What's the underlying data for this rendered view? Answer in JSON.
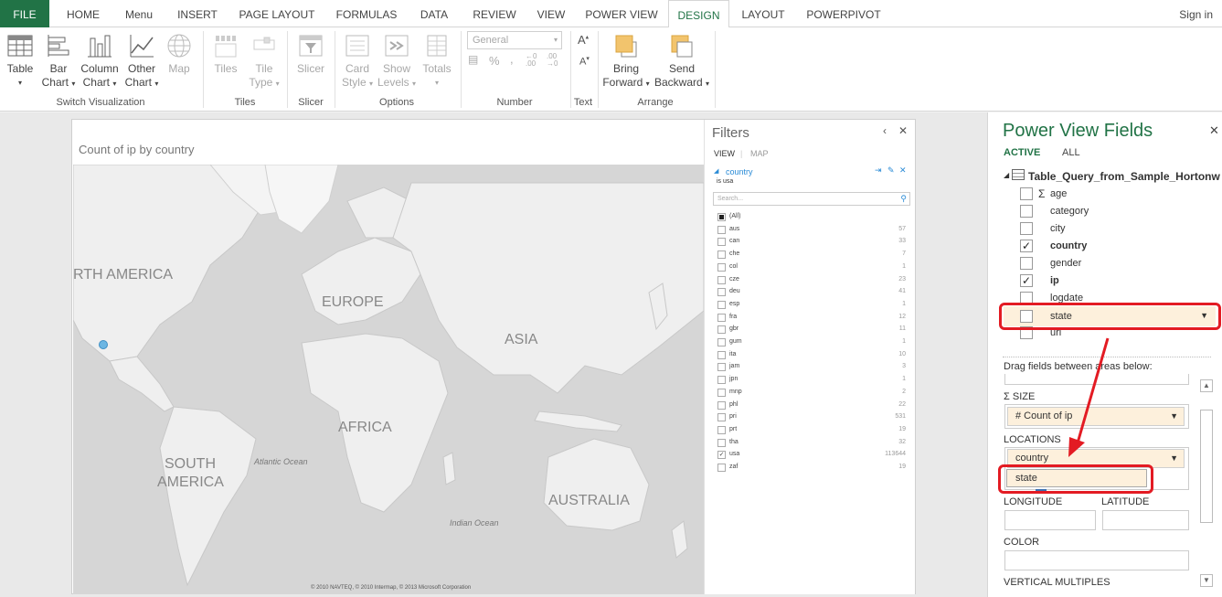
{
  "tabs": [
    "FILE",
    "HOME",
    "Menu",
    "INSERT",
    "PAGE LAYOUT",
    "FORMULAS",
    "DATA",
    "REVIEW",
    "VIEW",
    "POWER VIEW",
    "DESIGN",
    "LAYOUT",
    "POWERPIVOT"
  ],
  "signin": "Sign in",
  "ribbon": {
    "switch": {
      "table": [
        "Table"
      ],
      "bar": [
        "Bar",
        "Chart"
      ],
      "column": [
        "Column",
        "Chart"
      ],
      "other": [
        "Other",
        "Chart"
      ],
      "map": [
        "Map"
      ],
      "label": "Switch Visualization"
    },
    "tiles": {
      "tiles": [
        "Tiles"
      ],
      "tiletype": [
        "Tile",
        "Type"
      ],
      "label": "Tiles"
    },
    "slicer": {
      "slicer": [
        "Slicer"
      ],
      "label": "Slicer"
    },
    "options": {
      "card": [
        "Card",
        "Style"
      ],
      "levels": [
        "Show",
        "Levels"
      ],
      "totals": [
        "Totals"
      ],
      "label": "Options"
    },
    "number": {
      "format": "General",
      "label": "Number"
    },
    "text": {
      "label": "Text"
    },
    "arrange": {
      "forward": [
        "Bring",
        "Forward"
      ],
      "backward": [
        "Send",
        "Backward"
      ],
      "label": "Arrange"
    }
  },
  "map": {
    "title": "Count of ip by country",
    "labels": {
      "na": "RTH AMERICA",
      "europe": "EUROPE",
      "asia": "ASIA",
      "africa": "AFRICA",
      "sa1": "SOUTH",
      "sa2": "AMERICA",
      "australia": "AUSTRALIA",
      "atlantic": "Atlantic Ocean",
      "indian": "Indian Ocean"
    },
    "copyright": "© 2010 NAVTEQ, © 2010 Intermap, © 2013 Microsoft Corporation"
  },
  "filters": {
    "title": "Filters",
    "view": "VIEW",
    "mapTab": "MAP",
    "field": "country",
    "condition": "is usa",
    "search_placeholder": "Search...",
    "items": [
      {
        "label": "(All)",
        "count": "",
        "state": "partial"
      },
      {
        "label": "aus",
        "count": "57"
      },
      {
        "label": "can",
        "count": "33"
      },
      {
        "label": "che",
        "count": "7"
      },
      {
        "label": "col",
        "count": "1"
      },
      {
        "label": "cze",
        "count": "23"
      },
      {
        "label": "deu",
        "count": "41"
      },
      {
        "label": "esp",
        "count": "1"
      },
      {
        "label": "fra",
        "count": "12"
      },
      {
        "label": "gbr",
        "count": "11"
      },
      {
        "label": "gum",
        "count": "1"
      },
      {
        "label": "ita",
        "count": "10"
      },
      {
        "label": "jam",
        "count": "3"
      },
      {
        "label": "jpn",
        "count": "1"
      },
      {
        "label": "mnp",
        "count": "2"
      },
      {
        "label": "phl",
        "count": "22"
      },
      {
        "label": "pri",
        "count": "531"
      },
      {
        "label": "prt",
        "count": "19"
      },
      {
        "label": "tha",
        "count": "32"
      },
      {
        "label": "usa",
        "count": "113644",
        "checked": true
      },
      {
        "label": "zaf",
        "count": "19"
      }
    ]
  },
  "fields": {
    "title": "Power View Fields",
    "active": "ACTIVE",
    "all": "ALL",
    "table": "Table_Query_from_Sample_Hortonw",
    "list": [
      {
        "name": "age",
        "sigma": true,
        "checked": false
      },
      {
        "name": "category",
        "checked": false
      },
      {
        "name": "city",
        "checked": false
      },
      {
        "name": "country",
        "checked": true,
        "bold": true
      },
      {
        "name": "gender",
        "checked": false
      },
      {
        "name": "ip",
        "checked": true,
        "bold": true
      },
      {
        "name": "logdate",
        "checked": false
      },
      {
        "name": "state",
        "checked": false,
        "highlight": true
      },
      {
        "name": "url",
        "checked": false
      }
    ],
    "drag_hint": "Drag fields between areas below:",
    "size_label": "SIZE",
    "size_value": "# Count of ip",
    "locations_label": "LOCATIONS",
    "loc_value": "country",
    "loc_drag": "state",
    "longitude": "LONGITUDE",
    "latitude": "LATITUDE",
    "color": "COLOR",
    "vertical": "VERTICAL MULTIPLES"
  },
  "colors": {
    "excel_green": "#217346",
    "highlight_red": "#e31b23",
    "field_bg": "#fdf0dc",
    "dot": "#6cb6e3"
  }
}
